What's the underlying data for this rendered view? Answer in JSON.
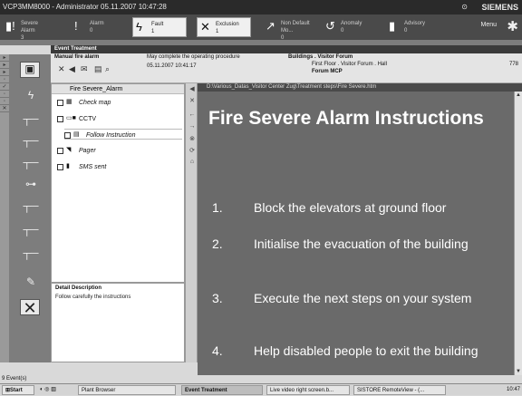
{
  "titlebar": {
    "title": "VCP3MM8000 - Administrator   05.11.2007 10:47:28",
    "brand": "SIEMENS"
  },
  "alarms": [
    {
      "label": "Severe Alarm",
      "count": "3",
      "icon": "alarm-severe-icon"
    },
    {
      "label": "Alarm",
      "count": "0",
      "icon": "alarm-icon"
    },
    {
      "label": "Fault",
      "count": "1",
      "icon": "lightning-icon"
    },
    {
      "label": "Exclusion",
      "count": "1",
      "icon": "exclusion-icon"
    },
    {
      "label": "Non Default Mo...",
      "count": "0",
      "icon": "arrow-icon"
    },
    {
      "label": "Anomaly",
      "count": "0",
      "icon": "anomaly-icon"
    },
    {
      "label": "Advisory",
      "count": "0",
      "icon": "advisory-icon"
    }
  ],
  "menu_label": "Menu",
  "event_header": "Event Treatment",
  "info": {
    "event_name": "Manual fire alarm",
    "instruction": "May complete the operating procedure",
    "datetime": "05.11.2007  10:41:17",
    "location_line1": "Buildings . Visitor Forum",
    "location_line2": "First Floor . Visitor Forum . Hall",
    "location_line3": "Forum MCP",
    "id": "778"
  },
  "steps_panel": {
    "header": "Fire Severe_Alarm",
    "steps": [
      {
        "label": "Check map",
        "icon": "map-icon"
      },
      {
        "label": "CCTV",
        "icon": "camera-icon"
      },
      {
        "label": "Follow Instruction",
        "icon": "document-icon"
      },
      {
        "label": "Pager",
        "icon": "pager-icon"
      },
      {
        "label": "SMS sent",
        "icon": "phone-icon"
      }
    ]
  },
  "detail": {
    "title": "Detail Description",
    "text": "Follow carefully the instructions"
  },
  "path": "D:\\Various_Datas_Visitor Center Zug\\Treatment steps\\Fire Severe.htm",
  "document": {
    "title": "Fire Severe Alarm Instructions",
    "items": [
      {
        "num": "1.",
        "text": "Block the elevators at ground floor"
      },
      {
        "num": "2.",
        "text": "Initialise the evacuation of the building"
      },
      {
        "num": "3.",
        "text": "Execute the next steps on your system"
      },
      {
        "num": "4.",
        "text": "Help disabled people to exit the building"
      }
    ]
  },
  "event_count": "9 Event(s)",
  "taskbar": {
    "start": "Start",
    "items": [
      "Plant Browser",
      "Event Treatment",
      "Live video right screen.b...",
      "SISTORE RemoteView - (..."
    ],
    "clock": "10:47"
  }
}
